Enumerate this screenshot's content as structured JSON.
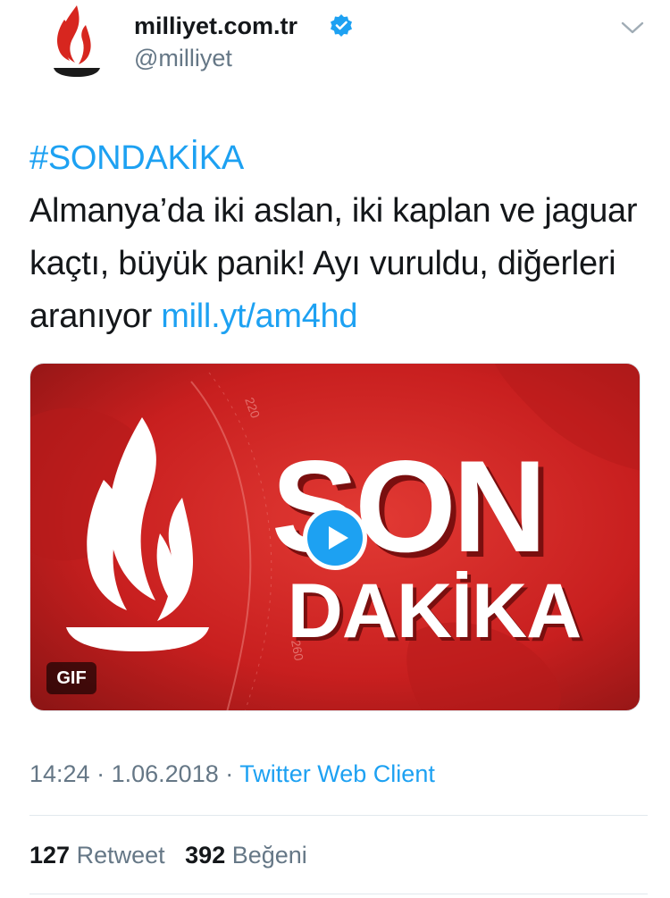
{
  "account": {
    "display_name": "milliyet.com.tr",
    "handle": "@milliyet",
    "verified": true,
    "avatar_icon": "milliyet-flame-logo-icon",
    "menu_icon": "chevron-down-icon"
  },
  "tweet": {
    "hashtag": "#SONDAKİKA",
    "text": "Almanya’da iki aslan, iki kaplan ve jaguar kaçtı, büyük panik! Ayı vuruldu, diğerleri aranıyor",
    "link": "mill.yt/am4hd"
  },
  "media": {
    "image_text_line1": "SON",
    "image_text_line2": "DAKİKA",
    "gauge_labels": [
      "220",
      "260"
    ],
    "badge": "GIF",
    "play_icon": "play-icon",
    "colors": {
      "red": "#d42a2a",
      "dark_red": "#8e1515",
      "link": "#1da1f2"
    }
  },
  "meta": {
    "time": "14:24",
    "sep1": "·",
    "date": "1.06.2018",
    "sep2": "·",
    "client": "Twitter Web Client"
  },
  "stats": {
    "retweets": "127",
    "retweet_label": "Retweet",
    "likes": "392",
    "like_label": "Beğeni"
  }
}
